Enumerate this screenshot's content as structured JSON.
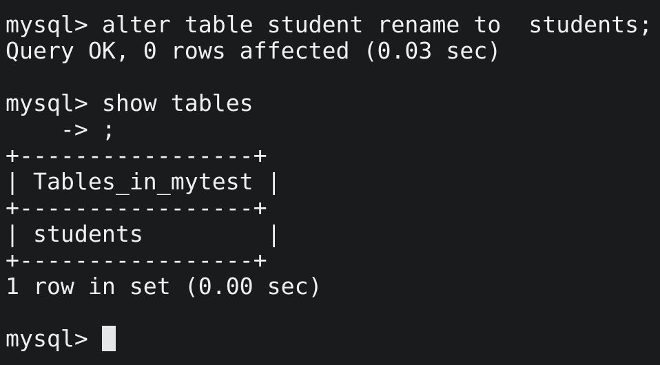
{
  "terminal": {
    "lines": [
      "mysql> alter table student rename to  students;",
      "Query OK, 0 rows affected (0.03 sec)",
      "",
      "mysql> show tables",
      "    -> ;",
      "+-----------------+",
      "| Tables_in_mytest |",
      "+-----------------+",
      "| students         |",
      "+-----------------+",
      "1 row in set (0.00 sec)",
      "",
      "mysql> "
    ]
  }
}
